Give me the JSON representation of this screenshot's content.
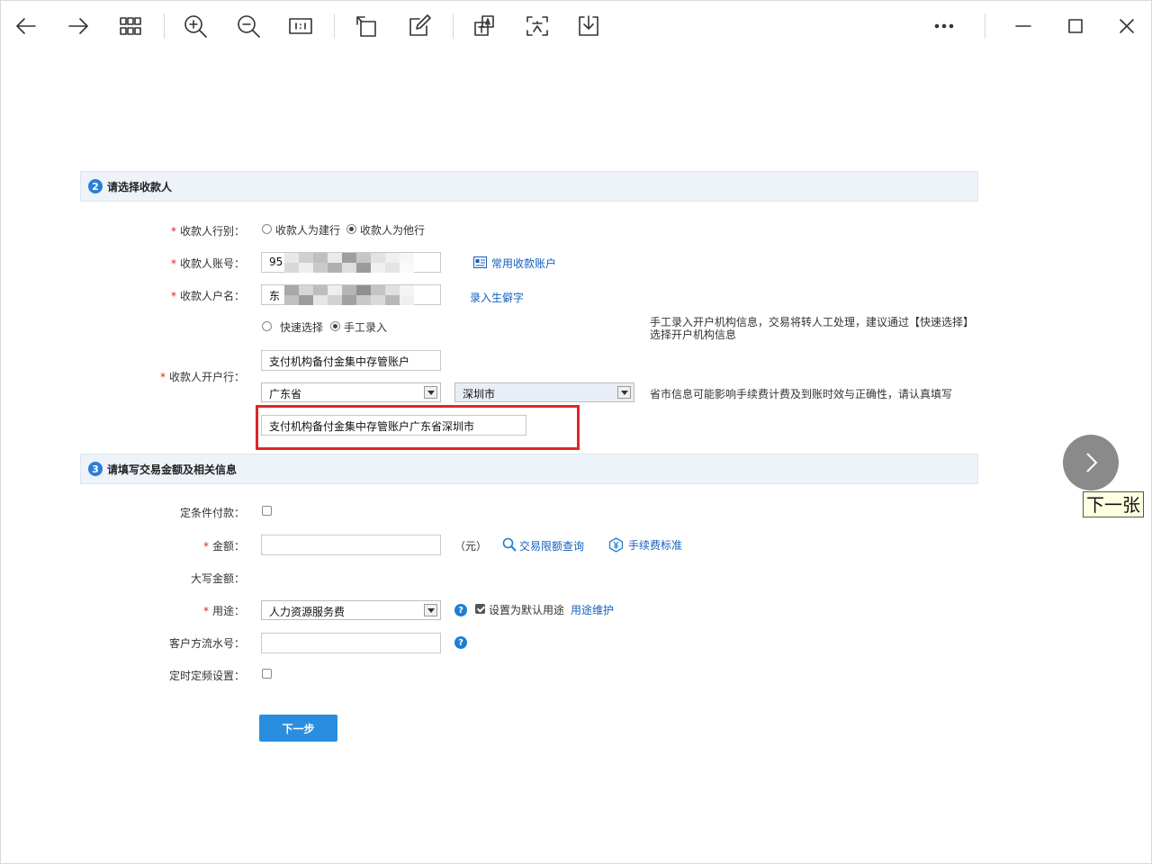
{
  "toolbar": {
    "back": "back-arrow",
    "forward": "forward-arrow",
    "grid": "grid",
    "zoom_in": "zoom-in",
    "zoom_out": "zoom-out",
    "actual_size": "actual-size",
    "rotate": "rotate",
    "edit": "edit",
    "translate": "translate",
    "ocr": "ocr",
    "save": "download",
    "more": "more",
    "minimize": "minimize",
    "maximize": "maximize",
    "close": "close"
  },
  "section2": {
    "num": "2",
    "title": "请选择收款人"
  },
  "payee_type": {
    "label": "收款人行别：",
    "opt1": "收款人为建行",
    "opt2": "收款人为他行",
    "selected": "收款人为他行"
  },
  "payee_account": {
    "label": "收款人账号：",
    "value_prefix": "95",
    "link": "常用收款账户"
  },
  "payee_name": {
    "label": "收款人户名：",
    "value_prefix": "东",
    "link": "录入生僻字"
  },
  "bank_mode": {
    "opt1": "快速选择",
    "opt2": "手工录入",
    "selected": "手工录入",
    "hint_line1": "手工录入开户机构信息，交易将转人工处理，建议通过【快速选择】",
    "hint_line2": "选择开户机构信息"
  },
  "payee_bank": {
    "label": "收款人开户行：",
    "name_value": "支付机构备付金集中存管账户",
    "province": "广东省",
    "city": "深圳市",
    "province_hint": "省市信息可能影响手续费计费及到账时效与正确性，请认真填写",
    "full_value": "支付机构备付金集中存管账户广东省深圳市"
  },
  "section3": {
    "num": "3",
    "title": "请填写交易金额及相关信息"
  },
  "conditional_pay": {
    "label": "定条件付款："
  },
  "amount": {
    "label": "金额：",
    "unit": "（元）",
    "limit_link": "交易限额查询",
    "fee_link": "手续费标准"
  },
  "amount_upper": {
    "label": "大写金额："
  },
  "purpose": {
    "label": "用途：",
    "value": "人力资源服务费",
    "default_label": "设置为默认用途",
    "maintain_link": "用途维护"
  },
  "client_serial": {
    "label": "客户方流水号："
  },
  "scheduled": {
    "label": "定时定频设置："
  },
  "next_button": "下一步",
  "viewer": {
    "next_tooltip": "下一张"
  }
}
